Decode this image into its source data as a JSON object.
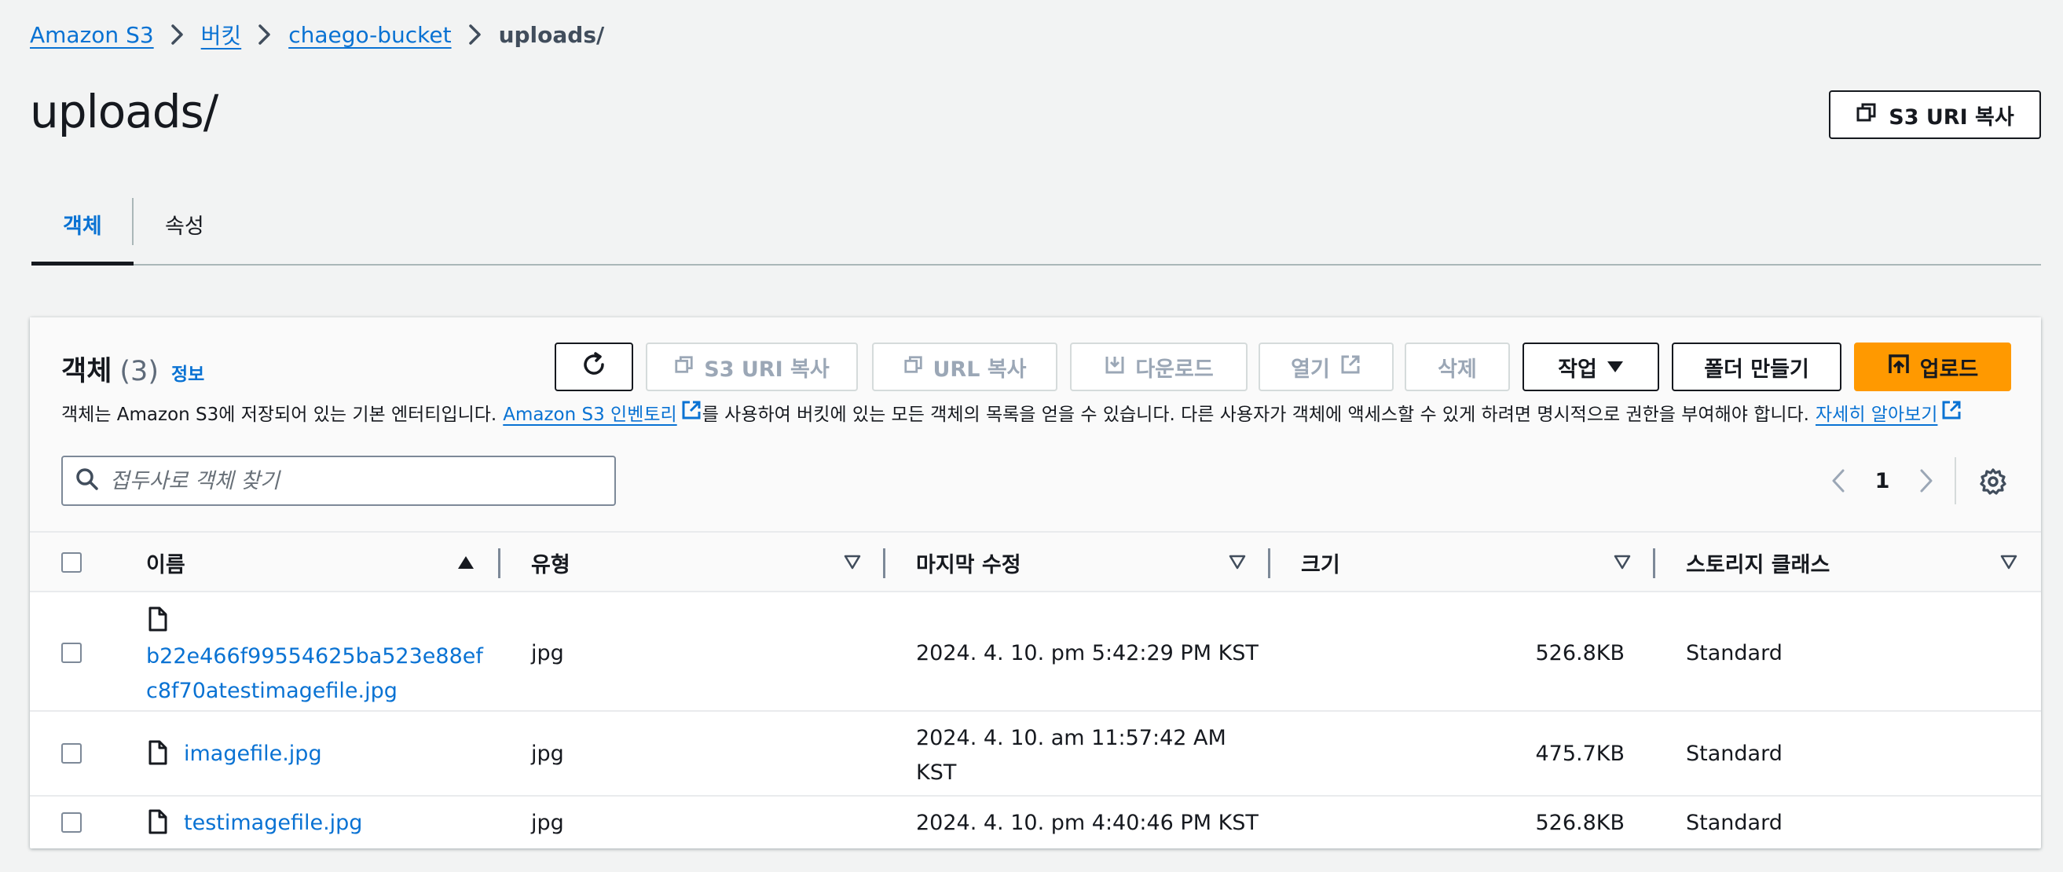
{
  "breadcrumb": [
    {
      "label": "Amazon S3"
    },
    {
      "label": "버킷"
    },
    {
      "label": "chaego-bucket"
    },
    {
      "label": "uploads/"
    }
  ],
  "page_title": "uploads/",
  "copy_uri_top_label": "S3 URI 복사",
  "tabs": [
    {
      "label": "객체",
      "active": true
    },
    {
      "label": "속성",
      "active": false
    }
  ],
  "objects_panel": {
    "title": "객체",
    "count": "(3)",
    "info_link": "정보",
    "description_part1": "객체는 Amazon S3에 저장되어 있는 기본 엔터티입니다.",
    "inventory_link": "Amazon S3 인벤토리",
    "description_part2": "를 사용하여 버킷에 있는 모든 객체의 목록을 얻을 수 있습니다. 다른 사용자가 객체에 액세스할 수 있게 하려면 명시적으로 권한을 부여해야 합니다.",
    "learn_more_link": "자세히 알아보기",
    "actions": {
      "refresh": "refresh",
      "copy_s3_uri": "S3 URI 복사",
      "copy_url": "URL 복사",
      "download": "다운로드",
      "open": "열기",
      "delete": "삭제",
      "actions_menu": "작업",
      "create_folder": "폴더 만들기",
      "upload": "업로드"
    },
    "search_placeholder": "접두사로 객체 찾기",
    "page_number": "1"
  },
  "table": {
    "columns": [
      "이름",
      "유형",
      "마지막 수정",
      "크기",
      "스토리지 클래스"
    ],
    "rows": [
      {
        "name_line1": "b22e466f99554625ba523e88ef",
        "name_line2": "c8f70atestimagefile.jpg",
        "type": "jpg",
        "modified_line1": "2024. 4. 10. pm 5:42:29 PM KST",
        "modified_line2": "",
        "size": "526.8KB",
        "storage_class": "Standard"
      },
      {
        "name_line1": "imagefile.jpg",
        "name_line2": "",
        "type": "jpg",
        "modified_line1": "2024. 4. 10. am 11:57:42 AM",
        "modified_line2": "KST",
        "size": "475.7KB",
        "storage_class": "Standard"
      },
      {
        "name_line1": "testimagefile.jpg",
        "name_line2": "",
        "type": "jpg",
        "modified_line1": "2024. 4. 10. pm 4:40:46 PM KST",
        "modified_line2": "",
        "size": "526.8KB",
        "storage_class": "Standard"
      }
    ]
  },
  "colors": {
    "link": "#0972d3",
    "primary": "#ff9900",
    "text": "#16191f",
    "background": "#f2f3f3"
  }
}
